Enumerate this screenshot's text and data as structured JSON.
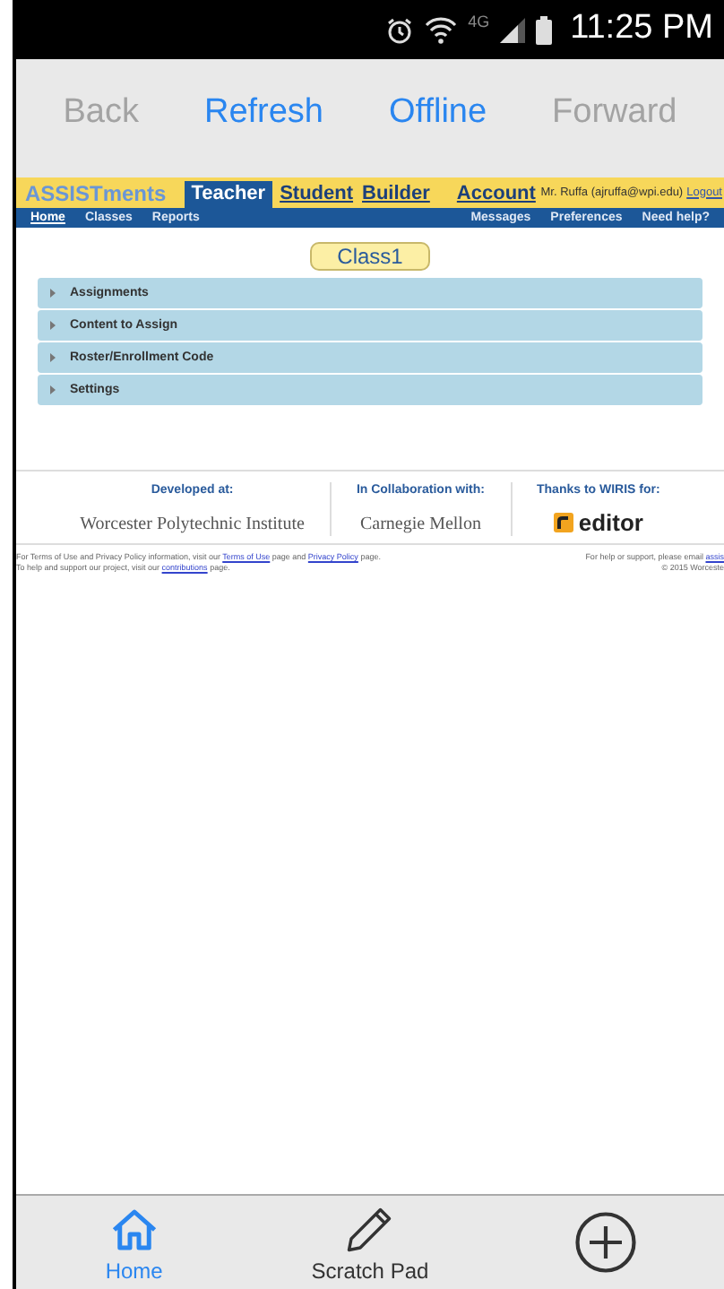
{
  "status_bar": {
    "time": "11:25 PM",
    "network": "4G"
  },
  "browser_toolbar": [
    {
      "label": "Back",
      "disabled": true
    },
    {
      "label": "Refresh",
      "disabled": false
    },
    {
      "label": "Offline",
      "disabled": false
    },
    {
      "label": "Forward",
      "disabled": true
    }
  ],
  "header": {
    "logo": "ASSISTments",
    "tabs": [
      {
        "label": "Teacher",
        "selected": true
      },
      {
        "label": "Student",
        "selected": false
      },
      {
        "label": "Builder",
        "selected": false
      },
      {
        "label": "Account",
        "selected": false
      }
    ],
    "user": "Mr. Ruffa (ajruffa@wpi.edu)",
    "logout": "Logout"
  },
  "nav_left": [
    {
      "label": "Home",
      "selected": true
    },
    {
      "label": "Classes",
      "selected": false
    },
    {
      "label": "Reports",
      "selected": false
    }
  ],
  "nav_right": [
    "Messages",
    "Preferences",
    "Need help?"
  ],
  "class_name": "Class1",
  "sections": [
    {
      "label": "Assignments",
      "expanded": false
    },
    {
      "label": "Content to Assign",
      "expanded": false
    },
    {
      "label": "Roster/Enrollment Code",
      "expanded": false
    },
    {
      "label": "Settings",
      "expanded": false
    }
  ],
  "footer": {
    "columns": [
      {
        "heading": "Developed at:",
        "name": "Worcester Polytechnic Institute",
        "kind": "serif"
      },
      {
        "heading": "In Collaboration with:",
        "name": "Carnegie Mellon",
        "kind": "serif"
      },
      {
        "heading": "Thanks to WIRIS for:",
        "name": "editor",
        "kind": "wiris"
      }
    ],
    "left_lines": [
      [
        "For Terms of Use and Privacy Policy information, visit our ",
        "Terms of Use",
        " page and ",
        "Privacy Policy",
        " page."
      ],
      [
        "To help and support our project, visit our ",
        "contributions",
        " page."
      ]
    ],
    "right_lines": [
      [
        "For help or support, please email ",
        "assis"
      ],
      [
        "© 2015 Worceste"
      ]
    ]
  },
  "bottom_tabs": [
    {
      "label": "Home",
      "kind": "home",
      "selected": true
    },
    {
      "label": "Scratch Pad",
      "kind": "pencil",
      "selected": false
    },
    {
      "kind": "plus",
      "selected": false
    }
  ]
}
